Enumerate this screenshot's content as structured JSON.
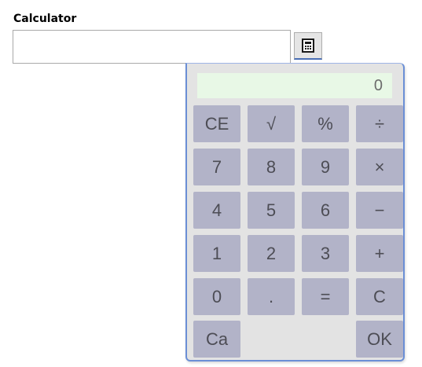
{
  "label": "Calculator",
  "input": {
    "value": "",
    "placeholder": ""
  },
  "trigger": {
    "icon": "calculator-icon"
  },
  "calculator": {
    "display": "0",
    "keys": {
      "ce": "CE",
      "sqrt": "√",
      "percent": "%",
      "divide": "÷",
      "seven": "7",
      "eight": "8",
      "nine": "9",
      "multiply": "×",
      "four": "4",
      "five": "5",
      "six": "6",
      "minus": "−",
      "one": "1",
      "two": "2",
      "three": "3",
      "plus": "+",
      "zero": "0",
      "decimal": ".",
      "equals": "=",
      "clear": "C",
      "cancel": "Ca",
      "ok": "OK"
    }
  },
  "colors": {
    "key_bg": "#b2b3c8",
    "panel_bg": "#e3e3e3",
    "display_bg": "#e8f8e6",
    "accent": "#6b8fd6"
  }
}
